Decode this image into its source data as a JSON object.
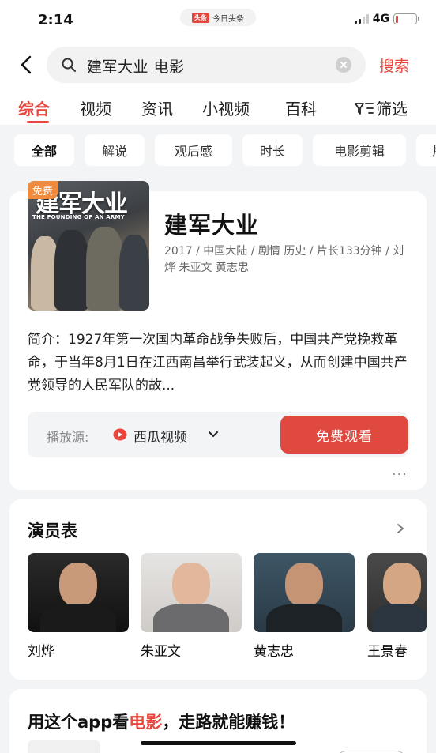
{
  "status_bar": {
    "time": "2:14",
    "app_badge": "头条",
    "app_name": "今日头条",
    "network": "4G",
    "battery_level": 0.15
  },
  "search": {
    "query": "建军大业 电影",
    "submit_label": "搜索"
  },
  "tabs": [
    {
      "label": "综合",
      "active": true
    },
    {
      "label": "视频"
    },
    {
      "label": "资讯"
    },
    {
      "label": "小视频"
    },
    {
      "label": "百科"
    }
  ],
  "filter_label": "筛选",
  "chips": [
    {
      "label": "全部",
      "active": true
    },
    {
      "label": "解说"
    },
    {
      "label": "观后感"
    },
    {
      "label": "时长"
    },
    {
      "label": "电影剪辑"
    },
    {
      "label": "片"
    }
  ],
  "movie": {
    "free_badge": "免费",
    "poster_title": "建军大业",
    "poster_subtitle": "THE FOUNDING OF AN ARMY",
    "title": "建军大业",
    "meta": "2017 / 中国大陆 / 剧情 历史 / 片长133分钟 / 刘烨 朱亚文 黄志忠",
    "synopsis": "简介：1927年第一次国内革命战争失败后，中国共产党挽救革命，于当年8月1日在江西南昌举行武装起义，从而创建中国共产党领导的人民军队的故...",
    "play_source_label": "播放源:",
    "play_source": "西瓜视频",
    "watch_button": "免费观看",
    "more": "···"
  },
  "cast": {
    "title": "演员表",
    "actors": [
      {
        "name": "刘烨"
      },
      {
        "name": "朱亚文"
      },
      {
        "name": "黄志忠"
      },
      {
        "name": "王景春"
      }
    ]
  },
  "promo": {
    "prefix": "用这个app看",
    "highlight": "电影",
    "suffix": "，走路就能赚钱！"
  },
  "colors": {
    "accent": "#e8453c",
    "button": "#e0493f",
    "badge": "#f08a3c",
    "background": "#f3f4f6"
  }
}
